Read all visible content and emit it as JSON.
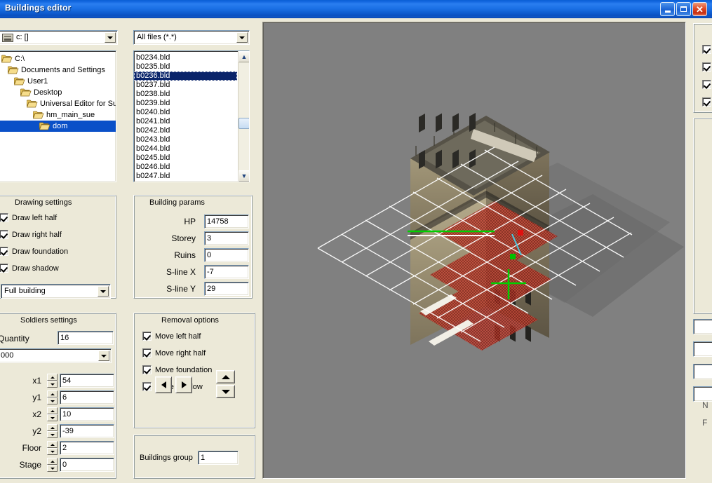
{
  "window": {
    "title": "Buildings editor",
    "minimize_label": "Minimize",
    "maximize_label": "Maximize",
    "close_label": "Close"
  },
  "file_browser": {
    "drive_combo": {
      "value": "c: []",
      "icon": "drive-icon"
    },
    "filter_combo": {
      "value": "All files (*.*)"
    },
    "directory_tree": [
      {
        "label": "C:\\",
        "depth": 0,
        "selected": false
      },
      {
        "label": "Documents and Settings",
        "depth": 1,
        "selected": false
      },
      {
        "label": "User1",
        "depth": 2,
        "selected": false
      },
      {
        "label": "Desktop",
        "depth": 3,
        "selected": false
      },
      {
        "label": "Universal Editor for Sust Gr",
        "depth": 4,
        "selected": false
      },
      {
        "label": "hm_main_sue",
        "depth": 5,
        "selected": false
      },
      {
        "label": "dom",
        "depth": 6,
        "selected": true
      }
    ],
    "file_list": [
      {
        "label": "b0234.bld",
        "selected": false
      },
      {
        "label": "b0235.bld",
        "selected": false
      },
      {
        "label": "b0236.bld",
        "selected": true
      },
      {
        "label": "b0237.bld",
        "selected": false
      },
      {
        "label": "b0238.bld",
        "selected": false
      },
      {
        "label": "b0239.bld",
        "selected": false
      },
      {
        "label": "b0240.bld",
        "selected": false
      },
      {
        "label": "b0241.bld",
        "selected": false
      },
      {
        "label": "b0242.bld",
        "selected": false
      },
      {
        "label": "b0243.bld",
        "selected": false
      },
      {
        "label": "b0244.bld",
        "selected": false
      },
      {
        "label": "b0245.bld",
        "selected": false
      },
      {
        "label": "b0246.bld",
        "selected": false
      },
      {
        "label": "b0247.bld",
        "selected": false
      }
    ]
  },
  "drawing_settings": {
    "title": "Drawing settings",
    "checkboxes": [
      {
        "label": "Draw left half",
        "checked": true
      },
      {
        "label": "Draw right half",
        "checked": true
      },
      {
        "label": "Draw foundation",
        "checked": true
      },
      {
        "label": "Draw shadow",
        "checked": true
      }
    ],
    "mode_combo": {
      "value": "Full building"
    }
  },
  "building_params": {
    "title": "Building params",
    "fields": [
      {
        "label": "HP",
        "value": "14758"
      },
      {
        "label": "Storey",
        "value": "3"
      },
      {
        "label": "Ruins",
        "value": "0"
      },
      {
        "label": "S-line X",
        "value": "-7"
      },
      {
        "label": "S-line Y",
        "value": "29"
      }
    ]
  },
  "soldiers_settings": {
    "title": "Soldiers settings",
    "quantity_label": "Quantity",
    "quantity_value": "16",
    "soldier_combo": {
      "value": "000"
    },
    "fields": [
      {
        "label": "x1",
        "value": "54"
      },
      {
        "label": "y1",
        "value": "6"
      },
      {
        "label": "x2",
        "value": "10"
      },
      {
        "label": "y2",
        "value": "-39"
      },
      {
        "label": "Floor",
        "value": "2"
      },
      {
        "label": "Stage",
        "value": "0"
      }
    ]
  },
  "removal_options": {
    "title": "Removal options",
    "checkboxes": [
      {
        "label": "Move left half",
        "checked": true
      },
      {
        "label": "Move right half",
        "checked": true
      },
      {
        "label": "Move foundation",
        "checked": true
      },
      {
        "label": "Move shadow",
        "checked": true
      }
    ],
    "nav_left_label": "◀",
    "nav_right_label": "▶",
    "step_up_label": "▲",
    "step_down_label": "▼"
  },
  "buildings_group": {
    "label": "Buildings group",
    "value": "1"
  },
  "right_panel": {
    "checkboxes": [
      {
        "checked": true
      },
      {
        "checked": true
      },
      {
        "checked": true
      },
      {
        "checked": true
      }
    ],
    "clipped_labels": [
      "N",
      "F"
    ]
  },
  "viewport": {
    "background_color": "#808080",
    "grid_color": "#ffffff",
    "marker_color": "#00c000",
    "overlay_color": "#cc2222",
    "shadow_color": "#6b6b6b"
  }
}
